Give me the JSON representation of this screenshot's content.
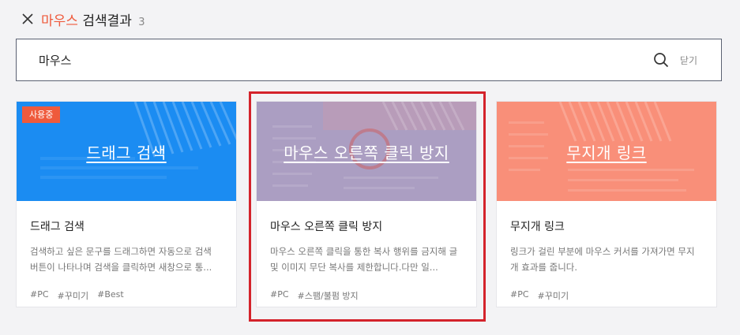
{
  "header": {
    "keyword": "마우스",
    "suffix": "검색결과",
    "count": "3"
  },
  "search": {
    "value": "마우스",
    "close_label": "닫기"
  },
  "cards": [
    {
      "thumb_title": "드래그 검색",
      "badge": "사용중",
      "name": "드래그 검색",
      "desc": "검색하고 싶은 문구를 드래그하면 자동으로 검색 버튼이 나타나며 검색을 클릭하면 새창으로 통...",
      "tags": [
        "#PC",
        "#꾸미기",
        "#Best"
      ],
      "color": "#1b8cf2"
    },
    {
      "thumb_title": "마우스 오른쪽 클릭 방지",
      "name": "마우스 오른쪽 클릭 방지",
      "desc": "마우스 오른쪽 클릭을 통한 복사 행위를 금지해 글 및 이미지 무단 복사를 제한합니다.다만 일...",
      "tags": [
        "#PC",
        "#스팸/불펌 방지"
      ],
      "color": "#a79abf"
    },
    {
      "thumb_title": "무지개 링크",
      "name": "무지개 링크",
      "desc": "링크가 걸린 부분에 마우스 커서를 가져가면 무지개 효과를 줍니다.",
      "tags": [
        "#PC",
        "#꾸미기"
      ],
      "color": "#f98f79"
    }
  ],
  "colors": {
    "accent": "#ef5a3c",
    "highlight": "#d4232b"
  }
}
